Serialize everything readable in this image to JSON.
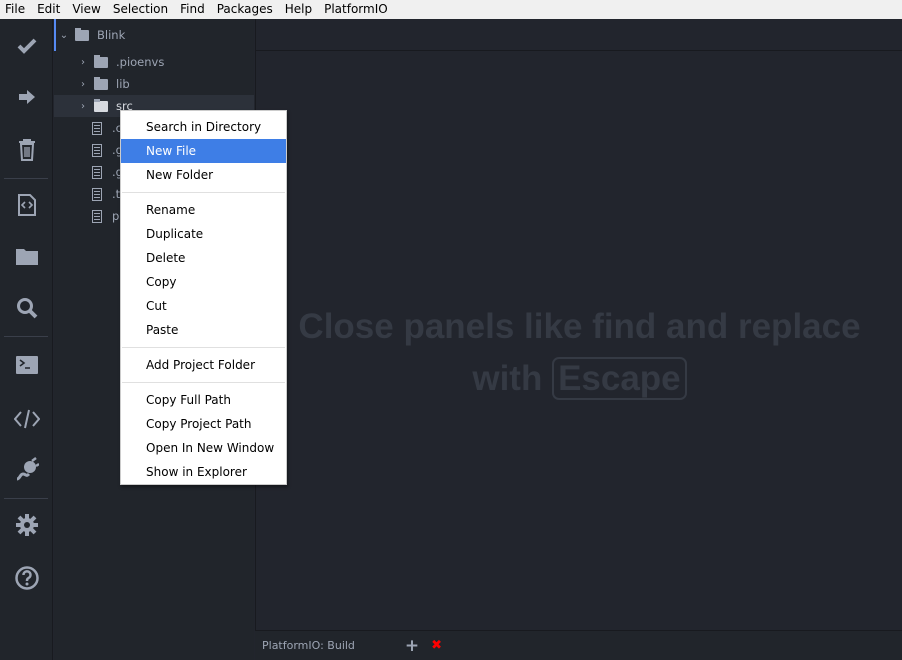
{
  "menubar": [
    "File",
    "Edit",
    "View",
    "Selection",
    "Find",
    "Packages",
    "Help",
    "PlatformIO"
  ],
  "activity_bar": [
    {
      "icon": "checkmark-icon",
      "label": "build"
    },
    {
      "icon": "arrow-right-icon",
      "label": "upload"
    },
    {
      "icon": "trash-icon",
      "label": "clean"
    },
    {
      "icon": "code-file-icon",
      "label": "new-file"
    },
    {
      "icon": "folder-icon",
      "label": "open-folder"
    },
    {
      "icon": "search-icon",
      "label": "search"
    },
    {
      "icon": "terminal-icon",
      "label": "terminal"
    },
    {
      "icon": "code-icon",
      "label": "code"
    },
    {
      "icon": "plug-icon",
      "label": "plug"
    },
    {
      "icon": "gear-icon",
      "label": "settings"
    },
    {
      "icon": "help-icon",
      "label": "help"
    }
  ],
  "tree": {
    "root": "Blink",
    "folders": [
      ".pioenvs",
      "lib",
      "src"
    ],
    "files": [
      ".c",
      ".g",
      ".g",
      ".t",
      "p"
    ],
    "selected": "src"
  },
  "context_menu": {
    "groups": [
      [
        "Search in Directory",
        "New File",
        "New Folder"
      ],
      [
        "Rename",
        "Duplicate",
        "Delete",
        "Copy",
        "Cut",
        "Paste"
      ],
      [
        "Add Project Folder"
      ],
      [
        "Copy Full Path",
        "Copy Project Path",
        "Open In New Window",
        "Show in Explorer"
      ]
    ],
    "highlighted": "New File",
    "highlight_color": "#3e7ee6"
  },
  "editor": {
    "hint_line1": "Close panels like find and replace",
    "hint_with": "with",
    "hint_key": "Escape"
  },
  "status": {
    "terminal_label": "PlatformIO: Build",
    "add_symbol": "+",
    "close_symbol": "✖",
    "close_color": "#ff0000"
  }
}
